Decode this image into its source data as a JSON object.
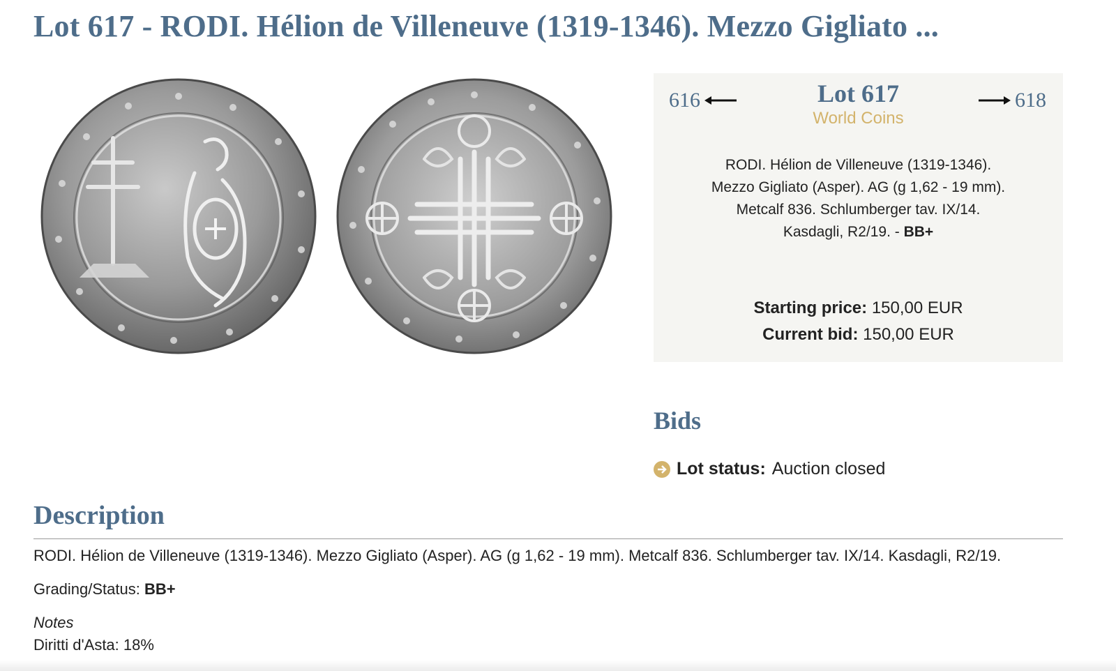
{
  "page": {
    "title": "Lot 617 - RODI. Hélion de Villeneuve (1319-1346). Mezzo Gigliato ..."
  },
  "images": {
    "obverse_icon": "coin-obverse-image",
    "reverse_icon": "coin-reverse-image"
  },
  "lot_box": {
    "prev_lot": "616",
    "next_lot": "618",
    "lot_number": "Lot 617",
    "category": "World Coins",
    "summary_lines": [
      "RODI. Hélion de Villeneuve (1319-1346).",
      "Mezzo Gigliato (Asper). AG (g 1,62 - 19 mm).",
      "Metcalf 836. Schlumberger tav. IX/14.",
      "Kasdagli, R2/19. - "
    ],
    "summary_grade": "BB+",
    "starting_price_label": "Starting price:",
    "starting_price_value": "150,00 EUR",
    "current_bid_label": "Current bid:",
    "current_bid_value": "150,00 EUR"
  },
  "bids": {
    "title": "Bids",
    "status_label": "Lot status:",
    "status_value": "Auction closed"
  },
  "description": {
    "title": "Description",
    "text": "RODI. Hélion de Villeneuve (1319-1346). Mezzo Gigliato (Asper). AG (g 1,62 - 19 mm). Metcalf 836. Schlumberger tav. IX/14. Kasdagli, R2/19.",
    "grading_label": "Grading/Status: ",
    "grading_value": "BB+",
    "notes_label": "Notes",
    "notes_text": "Diritti d'Asta: 18%"
  },
  "colors": {
    "accent_blue": "#4e6d8a",
    "gold": "#d3b36b",
    "panel_bg": "#f5f5f2"
  }
}
